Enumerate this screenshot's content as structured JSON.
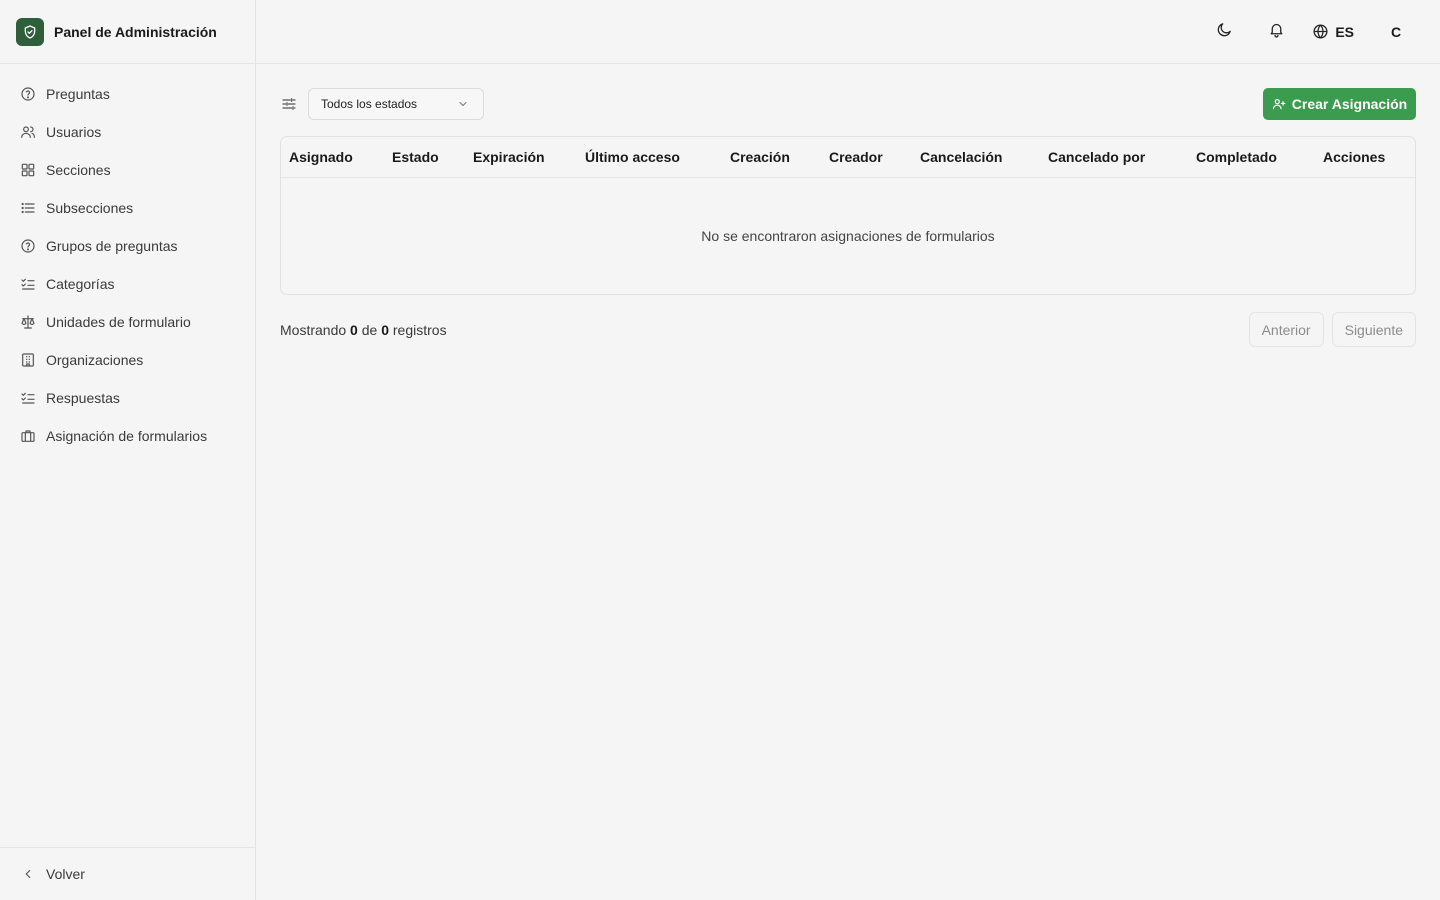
{
  "app": {
    "title": "Panel de Administración"
  },
  "sidebar": {
    "items": [
      {
        "label": "Preguntas",
        "icon": "help-circle-icon"
      },
      {
        "label": "Usuarios",
        "icon": "users-icon"
      },
      {
        "label": "Secciones",
        "icon": "grid-icon"
      },
      {
        "label": "Subsecciones",
        "icon": "list-icon"
      },
      {
        "label": "Grupos de preguntas",
        "icon": "help-circle-icon"
      },
      {
        "label": "Categorías",
        "icon": "list-checks-icon"
      },
      {
        "label": "Unidades de formulario",
        "icon": "scale-icon"
      },
      {
        "label": "Organizaciones",
        "icon": "building-icon"
      },
      {
        "label": "Respuestas",
        "icon": "list-checks-icon"
      },
      {
        "label": "Asignación de formularios",
        "icon": "briefcase-icon"
      }
    ],
    "footer_label": "Volver"
  },
  "header": {
    "language": "ES",
    "avatar_initial": "C"
  },
  "toolbar": {
    "status_filter": "Todos los estados",
    "create_label": "Crear Asignación"
  },
  "table": {
    "columns": [
      "Asignado",
      "Estado",
      "Expiración",
      "Último acceso",
      "Creación",
      "Creador",
      "Cancelación",
      "Cancelado por",
      "Completado",
      "Acciones"
    ],
    "empty_message": "No se encontraron asignaciones de formularios"
  },
  "pagination": {
    "prefix": "Mostrando",
    "shown": "0",
    "middle": "de",
    "total": "0",
    "suffix": "registros",
    "prev_label": "Anterior",
    "next_label": "Siguiente"
  },
  "colors": {
    "accent": "#3b9b4f",
    "brand": "#2f5f3a"
  }
}
